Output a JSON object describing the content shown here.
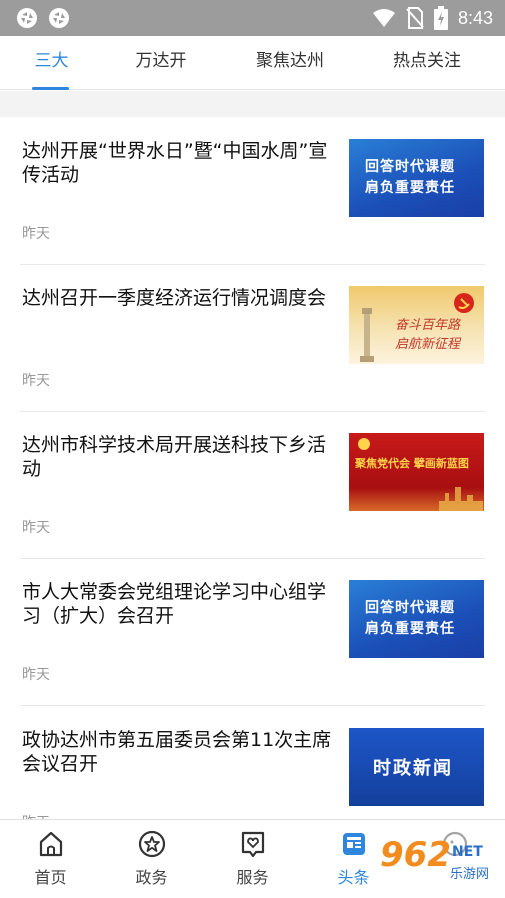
{
  "status_bar": {
    "time": "8:43",
    "icons": [
      "app-icon",
      "app-icon",
      "wifi-icon",
      "no-sim-icon",
      "battery-icon"
    ]
  },
  "tabs": [
    {
      "label": "三大",
      "active": true
    },
    {
      "label": "万达开",
      "active": false
    },
    {
      "label": "聚焦达州",
      "active": false
    },
    {
      "label": "热点关注",
      "active": false
    }
  ],
  "articles": [
    {
      "title": "达州开展“世界水日”暨“中国水周”宣传活动",
      "time": "昨天",
      "thumb_style": "blue",
      "thumb_caption": [
        "回答时代课题",
        "肩负重要责任"
      ]
    },
    {
      "title": "达州召开一季度经济运行情况调度会",
      "time": "昨天",
      "thumb_style": "party",
      "thumb_caption": [
        "奋斗百年路",
        "启航新征程"
      ]
    },
    {
      "title": "达州市科学技术局开展送科技下乡活动",
      "time": "昨天",
      "thumb_style": "red",
      "thumb_caption": [
        "聚焦党代会 擘画新蓝图"
      ]
    },
    {
      "title": "市人大常委会党组理论学习中心组学习（扩大）会召开",
      "time": "昨天",
      "thumb_style": "blue",
      "thumb_caption": [
        "回答时代课题",
        "肩负重要责任"
      ]
    },
    {
      "title": "政协达州市第五届委员会第11次主席会议召开",
      "time": "昨天",
      "thumb_style": "news",
      "thumb_caption": [
        "时政新闻"
      ]
    }
  ],
  "bottom_nav": [
    {
      "label": "首页",
      "icon": "home-icon",
      "active": false
    },
    {
      "label": "政务",
      "icon": "star-badge-icon",
      "active": false
    },
    {
      "label": "服务",
      "icon": "heart-box-icon",
      "active": false
    },
    {
      "label": "头条",
      "icon": "news-icon",
      "active": true
    },
    {
      "label": "",
      "icon": "profile-icon",
      "active": false
    }
  ],
  "watermark": {
    "brand": "962",
    "suffix": "NET",
    "subtitle": "乐游网"
  },
  "colors": {
    "accent": "#2e86de",
    "status_bar": "#9c9c9c",
    "separator": "#e8e8e8"
  }
}
